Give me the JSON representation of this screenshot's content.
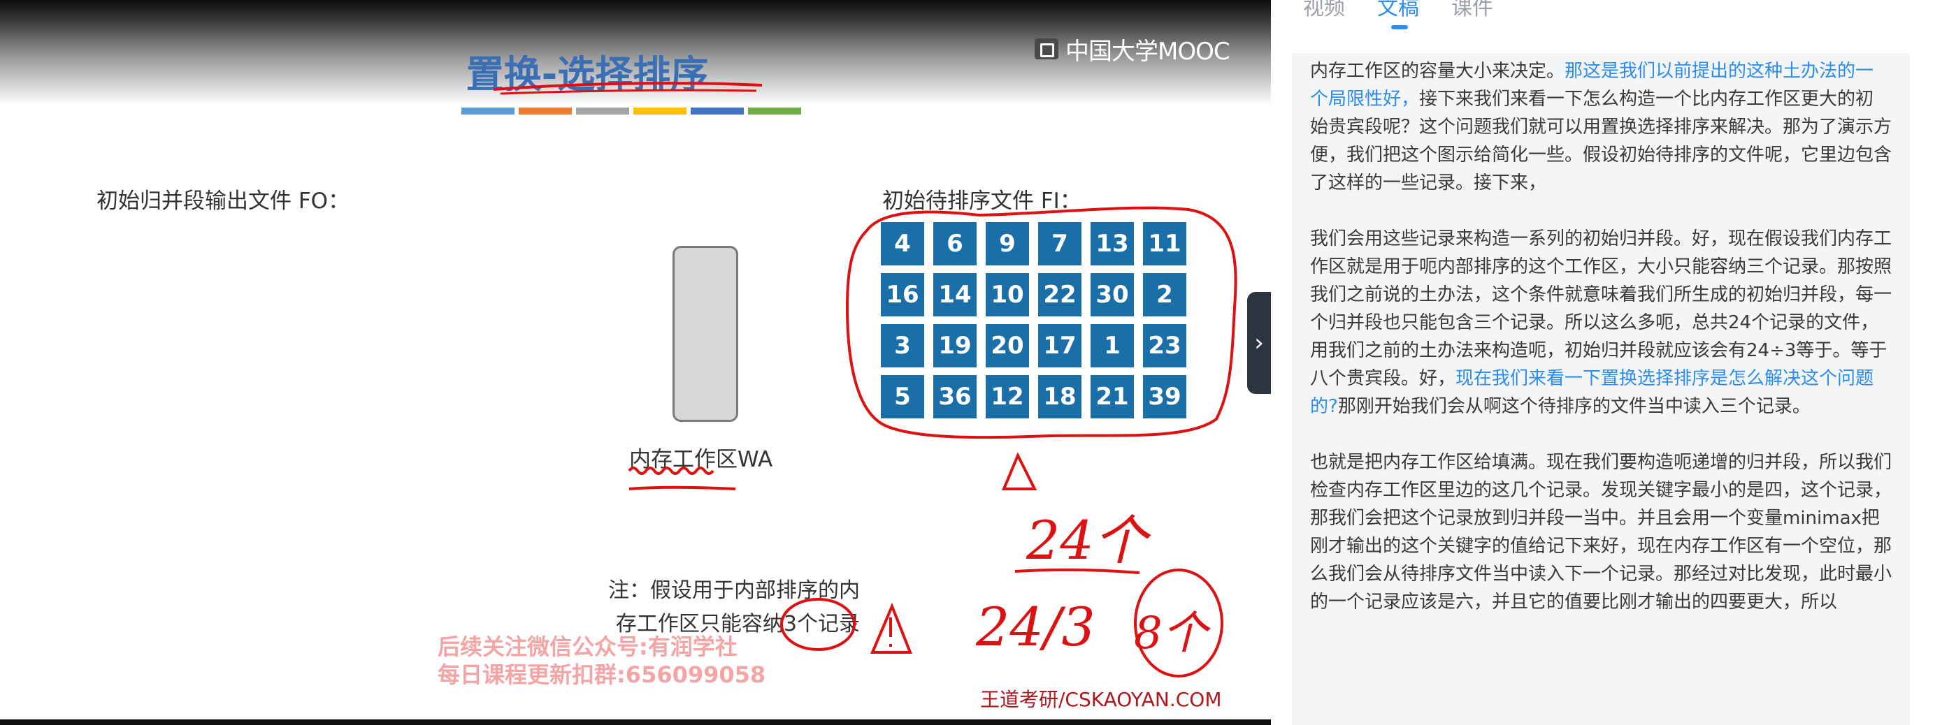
{
  "video": {
    "logo_text": "中国大学MOOC",
    "slide_title": "置换-选择排序",
    "color_bar": [
      "#5b9bd5",
      "#ed7d31",
      "#a5a5a5",
      "#ffc000",
      "#4472c4",
      "#70ad47"
    ],
    "label_output_file": "初始归并段输出文件 FO：",
    "label_input_file": "初始待排序文件 FI：",
    "memory_label": "内存工作区WA",
    "records": [
      4,
      6,
      9,
      7,
      13,
      11,
      16,
      14,
      10,
      22,
      30,
      2,
      3,
      19,
      20,
      17,
      1,
      23,
      5,
      36,
      12,
      18,
      21,
      39
    ],
    "note_line1": "注：假设用于内部排序的内",
    "note_line2": "存工作区只能容纳3个记录",
    "watermark_line1": "后续关注微信公众号:有润学社",
    "watermark_line2": "每日课程更新扣群:656099058",
    "credit": "王道考研/CSKAOYAN.COM",
    "handwriting": {
      "total": "24个",
      "division": "24/3",
      "result": "8个"
    }
  },
  "panel_toggle_icon": "chevron-right-icon",
  "panel": {
    "tabs": [
      "视频",
      "文稿",
      "课件"
    ],
    "active_tab": "文稿",
    "paragraphs": [
      [
        {
          "t": "内存工作区的容量大小来决定。",
          "hl": false
        },
        {
          "t": "那这是我们以前提出的这种土办法的一个局限性好，",
          "hl": true
        },
        {
          "t": "接下来我们来看一下怎么构造一个比内存工作区更大的初始贵宾段呢？这个问题我们就可以用置换选择排序来解决。那为了演示方便，我们把这个图示给简化一些。假设初始待排序的文件呢，它里边包含了这样的一些记录。接下来，",
          "hl": false
        }
      ],
      [
        {
          "t": "我们会用这些记录来构造一系列的初始归并段。好，现在假设我们内存工作区就是用于呃内部排序的这个工作区，大小只能容纳三个记录。那按照我们之前说的土办法，这个条件就意味着我们所生成的初始归并段，每一个归并段也只能包含三个记录。所以这么多呃，总共24个记录的文件，用我们之前的土办法来构造呃，初始归并段就应该会有24÷3等于。等于八个贵宾段。好，",
          "hl": false
        },
        {
          "t": "现在我们来看一下置换选择排序是怎么解决这个问题的?",
          "hl": true
        },
        {
          "t": "那刚开始我们会从啊这个待排序的文件当中读入三个记录。",
          "hl": false
        }
      ],
      [
        {
          "t": "也就是把内存工作区给填满。现在我们要构造呃递增的归并段，所以我们检查内存工作区里边的这几个记录。发现关键字最小的是四，这个记录，那我们会把这个记录放到归并段一当中。并且会用一个变量minimax把刚才输出的这个关键字的值给记下来好，现在内存工作区有一个空位，那么我们会从待排序文件当中读入下一个记录。那经过对比发现，此时最小的一个记录应该是六，并且它的值要比刚才输出的四要更大，所以",
          "hl": false
        }
      ]
    ]
  }
}
